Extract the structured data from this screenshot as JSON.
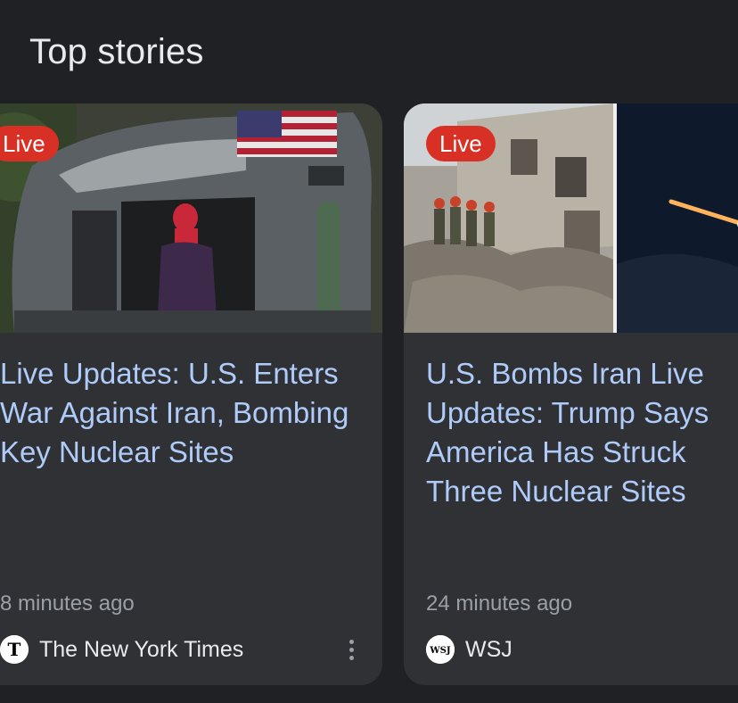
{
  "section": {
    "title": "Top stories"
  },
  "cards": [
    {
      "badge": "Live",
      "headline": "Live Updates: U.S. Enters War Against Iran, Bombing Key Nuclear Sites",
      "timestamp": "8 minutes ago",
      "source": "The New York Times",
      "source_logo_text": "T",
      "image": "helicopter-photo"
    },
    {
      "badge": "Live",
      "headline": "U.S. Bombs Iran Live Updates: Trump Says America Has Struck Three Nuclear Sites",
      "timestamp": "24 minutes ago",
      "source": "WSJ",
      "source_logo_text": "WSJ",
      "image": "rubble-and-missile-photo"
    }
  ],
  "colors": {
    "background": "#202124",
    "card": "#303134",
    "headline": "#aecbfa",
    "live_badge": "#d93025",
    "meta_text": "#9aa0a6"
  },
  "icons": {
    "more": "more-vert-icon"
  }
}
